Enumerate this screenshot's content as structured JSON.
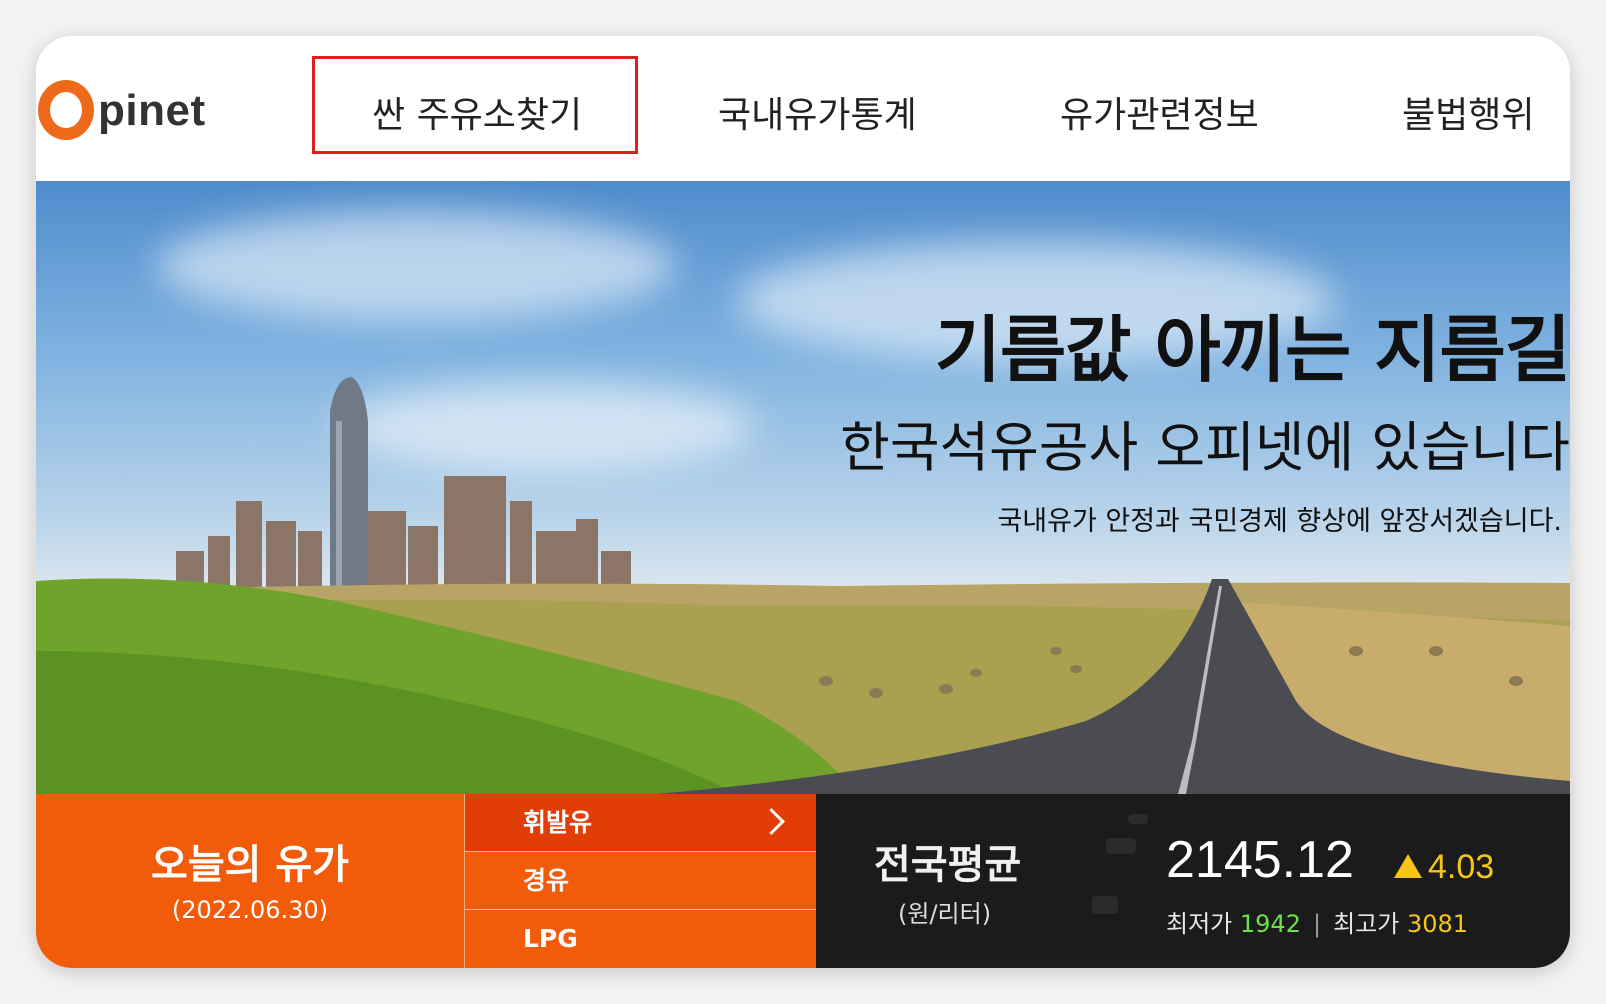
{
  "brand": {
    "logo_text": "pinet"
  },
  "nav": {
    "items": [
      "싼 주유소찾기",
      "국내유가통계",
      "유가관련정보",
      "불법행위"
    ],
    "highlight_color": "#e01e1e"
  },
  "hero": {
    "title": "기름값 아끼는 지름길",
    "subtitle": "한국석유공사 오피넷에 있습니다",
    "description": "국내유가 안정과 국민경제 향상에 앞장서겠습니다."
  },
  "today": {
    "title": "오늘의 유가",
    "date": "(2022.06.30)",
    "fuels": [
      "휘발유",
      "경유",
      "LPG"
    ],
    "selected": "휘발유"
  },
  "stats": {
    "title": "전국평균",
    "unit": "(원/리터)",
    "average": "2145.12",
    "change": "4.03",
    "change_direction": "up",
    "min_label": "최저가",
    "min_value": "1942",
    "max_label": "최고가",
    "max_value": "3081"
  },
  "colors": {
    "brand_orange": "#f25b09",
    "up_yellow": "#f5c518",
    "low_green": "#6ee04a"
  }
}
